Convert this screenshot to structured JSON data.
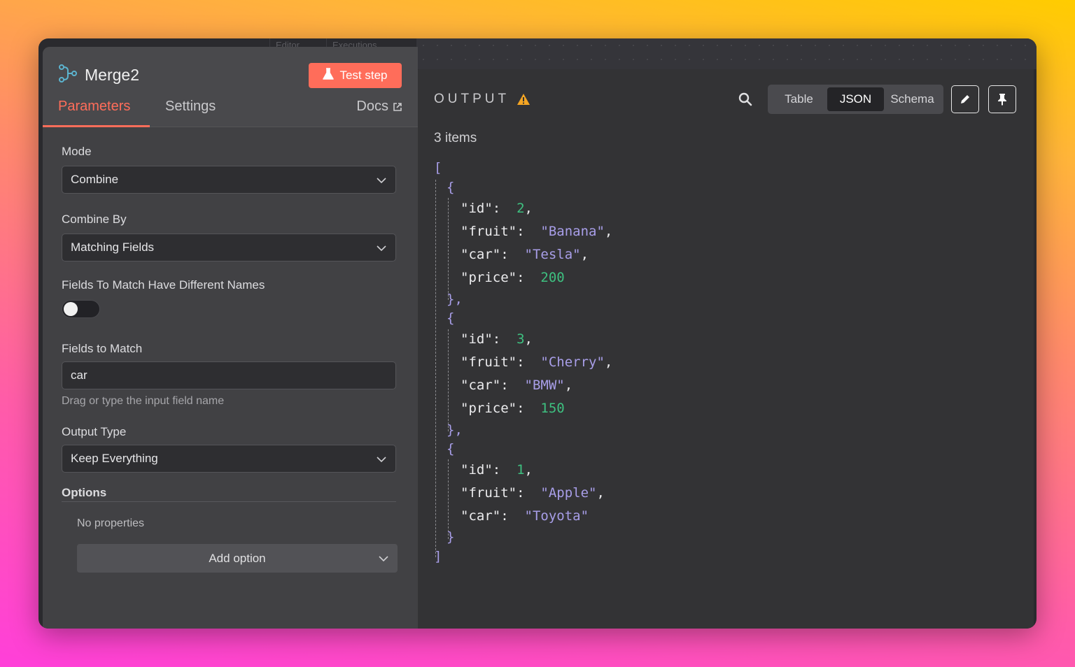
{
  "background_tabs": [
    "Editor",
    "Executions"
  ],
  "node": {
    "title": "Merge2",
    "icon": "merge-node-icon",
    "test_button": "Test step",
    "accent_color": "#ff6d5a"
  },
  "tabs": {
    "parameters": "Parameters",
    "settings": "Settings",
    "docs": "Docs"
  },
  "form": {
    "mode_label": "Mode",
    "mode_value": "Combine",
    "combine_by_label": "Combine By",
    "combine_by_value": "Matching Fields",
    "different_names_label": "Fields To Match Have Different Names",
    "different_names_enabled": false,
    "fields_to_match_label": "Fields to Match",
    "fields_to_match_value": "car",
    "fields_to_match_hint": "Drag or type the input field name",
    "output_type_label": "Output Type",
    "output_type_value": "Keep Everything",
    "options_label": "Options",
    "no_properties": "No properties",
    "add_option": "Add option"
  },
  "output": {
    "title": "OUTPUT",
    "warning_icon": "warning-icon",
    "views": [
      "Table",
      "JSON",
      "Schema"
    ],
    "active_view": "JSON",
    "items_count": "3 items",
    "items": [
      {
        "id": "2",
        "fruit": "\"Banana\"",
        "car": "\"Tesla\"",
        "price": "200"
      },
      {
        "id": "3",
        "fruit": "\"Cherry\"",
        "car": "\"BMW\"",
        "price": "150"
      },
      {
        "id": "1",
        "fruit": "\"Apple\"",
        "car": "\"Toyota\""
      }
    ],
    "keys": {
      "id": "\"id\"",
      "fruit": "\"fruit\"",
      "car": "\"car\"",
      "price": "\"price\""
    },
    "json_colors": {
      "bracket": "#a89ee8",
      "number": "#3ec080",
      "string": "#a89ee8"
    }
  }
}
